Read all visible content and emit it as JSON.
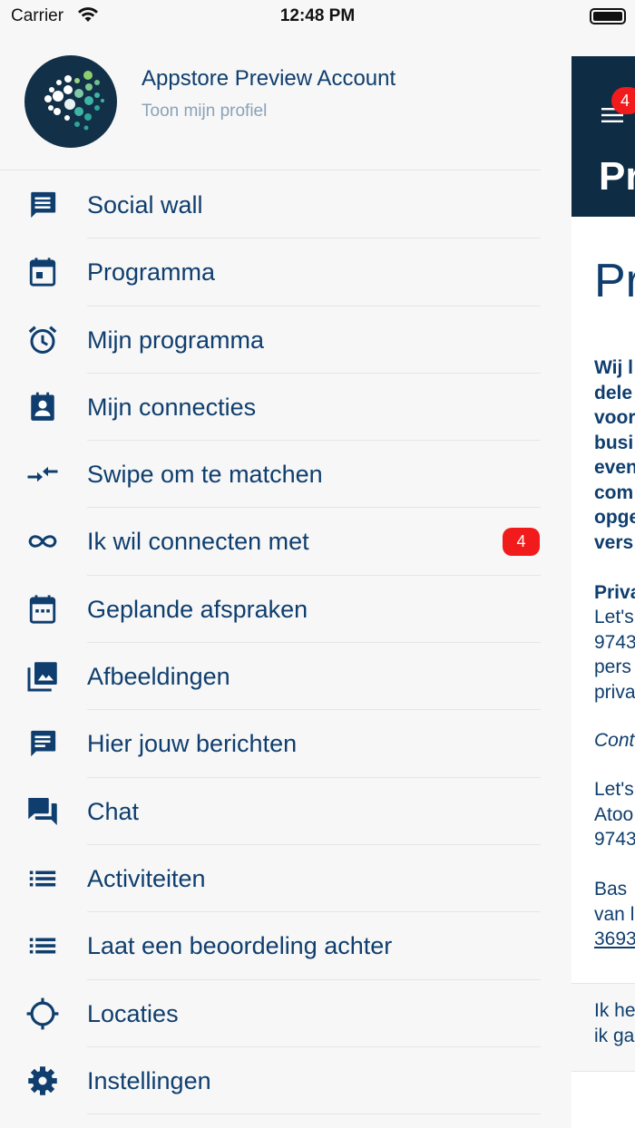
{
  "status_bar": {
    "carrier": "Carrier",
    "time": "12:48 PM"
  },
  "profile": {
    "name": "Appstore Preview Account",
    "link": "Toon mijn profiel"
  },
  "menu": [
    {
      "label": "Social wall",
      "icon": "social-wall-icon"
    },
    {
      "label": "Programma",
      "icon": "calendar-icon"
    },
    {
      "label": "Mijn programma",
      "icon": "alarm-icon"
    },
    {
      "label": "Mijn connecties",
      "icon": "contact-card-icon"
    },
    {
      "label": "Swipe om te matchen",
      "icon": "swap-arrows-icon"
    },
    {
      "label": "Ik wil connecten met",
      "icon": "infinity-icon",
      "badge": "4"
    },
    {
      "label": "Geplande afspraken",
      "icon": "calendar-dots-icon"
    },
    {
      "label": "Afbeeldingen",
      "icon": "image-library-icon"
    },
    {
      "label": "Hier jouw berichten",
      "icon": "message-icon"
    },
    {
      "label": "Chat",
      "icon": "chat-bubbles-icon"
    },
    {
      "label": "Activiteiten",
      "icon": "list-icon"
    },
    {
      "label": "Laat een beoordeling achter",
      "icon": "list-icon"
    },
    {
      "label": "Locaties",
      "icon": "crosshair-icon"
    },
    {
      "label": "Instellingen",
      "icon": "gear-icon"
    }
  ],
  "background_screen": {
    "nav_badge": "4",
    "nav_title": "Pr",
    "heading": "Pr",
    "bold_lines": "Wij l\ndele\nvoor\nbusi\neven\ncom\nopge\nvers",
    "privacy_title": "Priva",
    "privacy_lines": "Let's\n9743\npers\npriva",
    "contact_label": "Cont",
    "address_lines": "Let's\nAtoo\n9743",
    "person_lines": "Bas \nvan l",
    "phone": "3693",
    "footer_lines": "Ik he\nik ga"
  },
  "colors": {
    "brand_navy": "#0f2c45",
    "text_blue": "#0f3e6e",
    "badge_red": "#f21b1b"
  }
}
